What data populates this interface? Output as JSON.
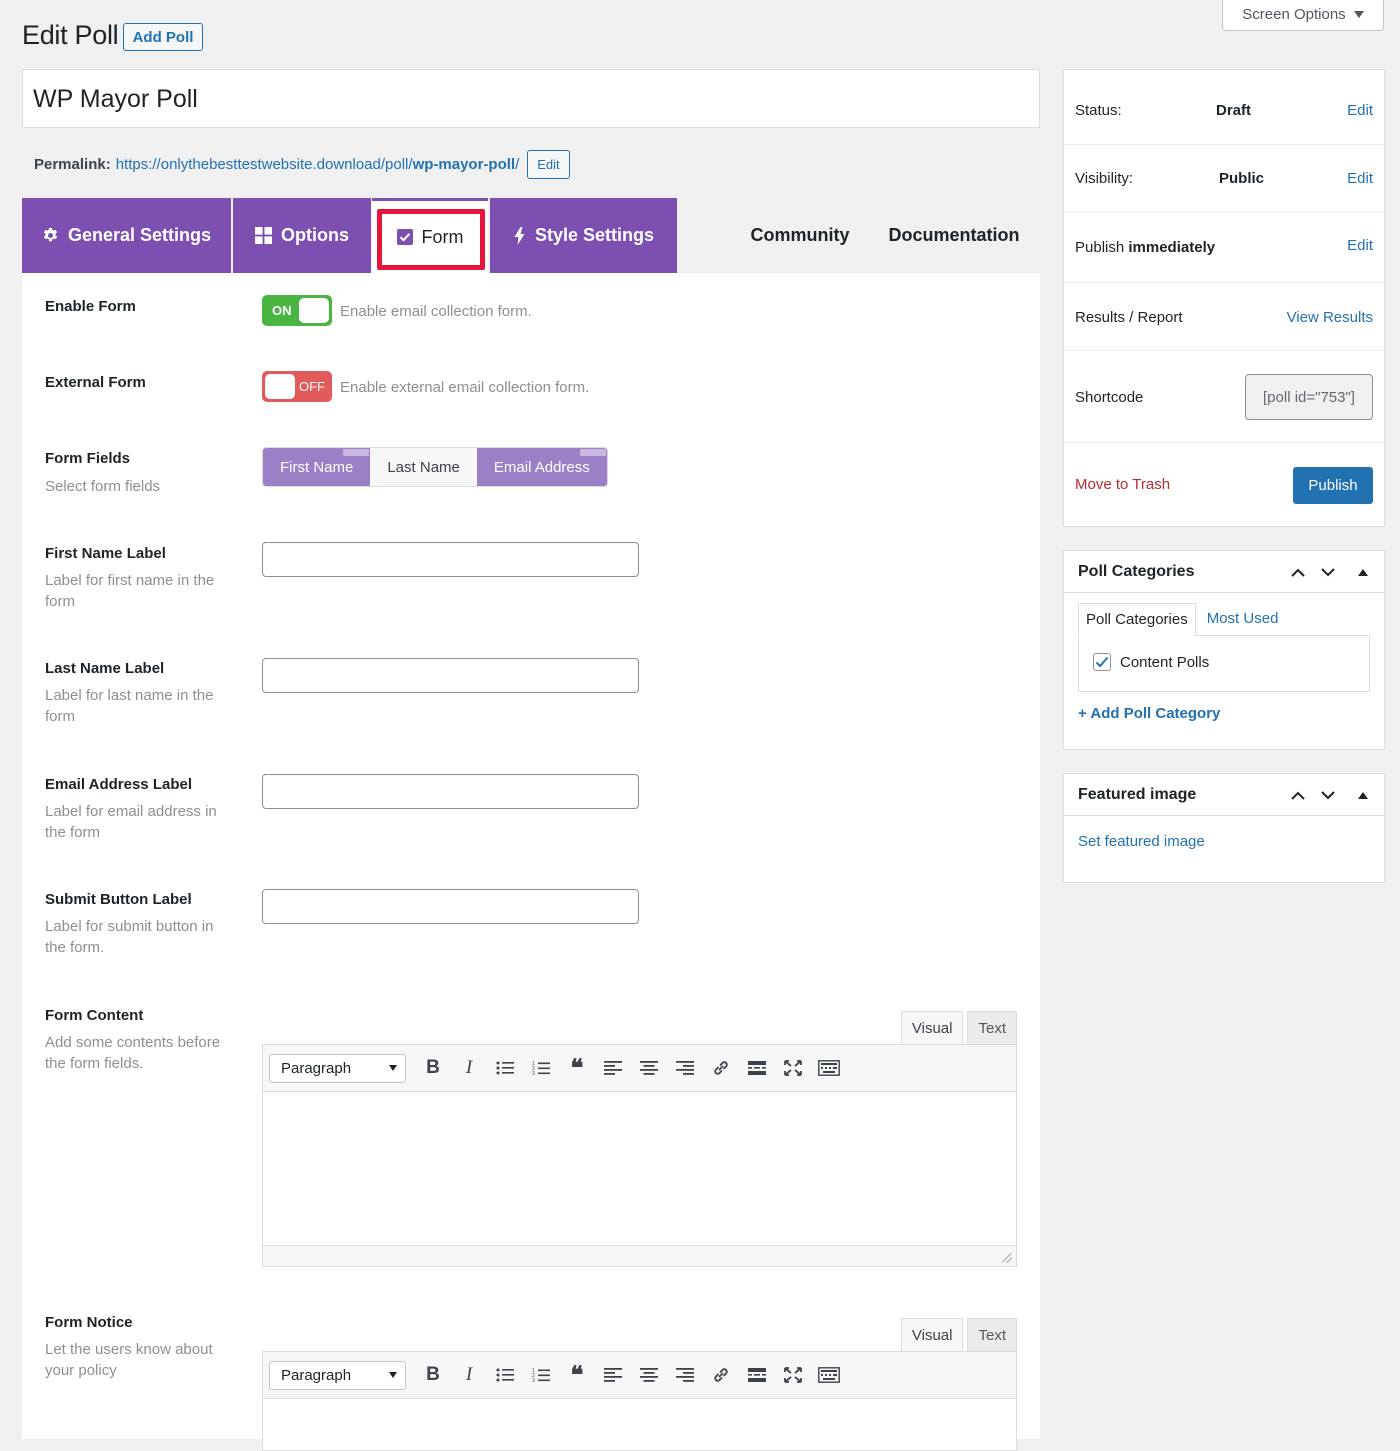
{
  "header": {
    "title": "Edit Poll",
    "add_button": "Add Poll",
    "screen_options": "Screen Options"
  },
  "post": {
    "title": "WP Mayor Poll",
    "permalink_label": "Permalink:",
    "permalink_base": "https://onlythebesttestwebsite.download/poll/",
    "permalink_slug": "wp-mayor-poll",
    "permalink_trailing": "/",
    "permalink_edit": "Edit"
  },
  "tabs": {
    "general": "General Settings",
    "options": "Options",
    "form": "Form",
    "style": "Style Settings",
    "community": "Community",
    "documentation": "Documentation"
  },
  "form": {
    "enable_form": {
      "label": "Enable Form",
      "state": "ON",
      "desc": "Enable email collection form."
    },
    "external_form": {
      "label": "External Form",
      "state": "OFF",
      "desc": "Enable external email collection form."
    },
    "form_fields": {
      "label": "Form Fields",
      "desc": "Select form fields",
      "options": [
        {
          "label": "First Name",
          "active": true
        },
        {
          "label": "Last Name",
          "active": false
        },
        {
          "label": "Email Address",
          "active": true
        }
      ]
    },
    "first_name_label": {
      "label": "First Name Label",
      "desc": "Label for first name in the form",
      "value": ""
    },
    "last_name_label": {
      "label": "Last Name Label",
      "desc": "Label for last name in the form",
      "value": ""
    },
    "email_label": {
      "label": "Email Address Label",
      "desc": "Label for email address in the form",
      "value": ""
    },
    "submit_label": {
      "label": "Submit Button Label",
      "desc": "Label for submit button in the form.",
      "value": ""
    },
    "form_content": {
      "label": "Form Content",
      "desc": "Add some contents before the form fields."
    },
    "form_notice": {
      "label": "Form Notice",
      "desc": "Let the users know about your policy"
    }
  },
  "editor": {
    "tab_visual": "Visual",
    "tab_text": "Text",
    "format": "Paragraph",
    "bold": "B",
    "italic": "I",
    "quote": "❝"
  },
  "publish": {
    "status_label": "Status:",
    "status_value": "Draft",
    "visibility_label": "Visibility:",
    "visibility_value": "Public",
    "publish_label": "Publish",
    "publish_value": "immediately",
    "edit": "Edit",
    "results_label": "Results / Report",
    "results_link": "View Results",
    "shortcode_label": "Shortcode",
    "shortcode_value": "[poll id=\"753\"]",
    "trash": "Move to Trash",
    "publish_button": "Publish"
  },
  "categories": {
    "title": "Poll Categories",
    "tab_all": "Poll Categories",
    "tab_used": "Most Used",
    "items": [
      {
        "label": "Content Polls",
        "checked": true
      }
    ],
    "add": "+ Add Poll Category"
  },
  "featured": {
    "title": "Featured image",
    "link": "Set featured image"
  },
  "colors": {
    "tab_purple": "#7c4fb1",
    "highlight_red": "#e5163b",
    "toggle_on": "#4bb543",
    "toggle_off": "#e25b5b",
    "wp_blue": "#2271b1"
  }
}
